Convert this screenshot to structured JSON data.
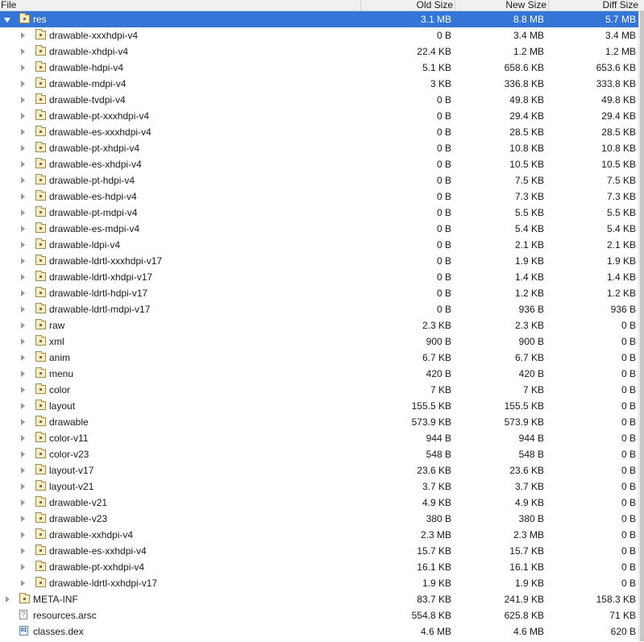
{
  "header": {
    "file": "File",
    "old_size": "Old Size",
    "new_size": "New Size",
    "diff_size": "Diff Size"
  },
  "rows": [
    {
      "name": "res",
      "old": "3.1 MB",
      "new": "8.8 MB",
      "diff": "5.7 MB",
      "level": 0,
      "type": "folder",
      "expanded": true,
      "selected": true
    },
    {
      "name": "drawable-xxxhdpi-v4",
      "old": "0 B",
      "new": "3.4 MB",
      "diff": "3.4 MB",
      "level": 1,
      "type": "folder"
    },
    {
      "name": "drawable-xhdpi-v4",
      "old": "22.4 KB",
      "new": "1.2 MB",
      "diff": "1.2 MB",
      "level": 1,
      "type": "folder"
    },
    {
      "name": "drawable-hdpi-v4",
      "old": "5.1 KB",
      "new": "658.6 KB",
      "diff": "653.6 KB",
      "level": 1,
      "type": "folder"
    },
    {
      "name": "drawable-mdpi-v4",
      "old": "3 KB",
      "new": "336.8 KB",
      "diff": "333.8 KB",
      "level": 1,
      "type": "folder"
    },
    {
      "name": "drawable-tvdpi-v4",
      "old": "0 B",
      "new": "49.8 KB",
      "diff": "49.8 KB",
      "level": 1,
      "type": "folder"
    },
    {
      "name": "drawable-pt-xxxhdpi-v4",
      "old": "0 B",
      "new": "29.4 KB",
      "diff": "29.4 KB",
      "level": 1,
      "type": "folder"
    },
    {
      "name": "drawable-es-xxxhdpi-v4",
      "old": "0 B",
      "new": "28.5 KB",
      "diff": "28.5 KB",
      "level": 1,
      "type": "folder"
    },
    {
      "name": "drawable-pt-xhdpi-v4",
      "old": "0 B",
      "new": "10.8 KB",
      "diff": "10.8 KB",
      "level": 1,
      "type": "folder"
    },
    {
      "name": "drawable-es-xhdpi-v4",
      "old": "0 B",
      "new": "10.5 KB",
      "diff": "10.5 KB",
      "level": 1,
      "type": "folder"
    },
    {
      "name": "drawable-pt-hdpi-v4",
      "old": "0 B",
      "new": "7.5 KB",
      "diff": "7.5 KB",
      "level": 1,
      "type": "folder"
    },
    {
      "name": "drawable-es-hdpi-v4",
      "old": "0 B",
      "new": "7.3 KB",
      "diff": "7.3 KB",
      "level": 1,
      "type": "folder"
    },
    {
      "name": "drawable-pt-mdpi-v4",
      "old": "0 B",
      "new": "5.5 KB",
      "diff": "5.5 KB",
      "level": 1,
      "type": "folder"
    },
    {
      "name": "drawable-es-mdpi-v4",
      "old": "0 B",
      "new": "5.4 KB",
      "diff": "5.4 KB",
      "level": 1,
      "type": "folder"
    },
    {
      "name": "drawable-ldpi-v4",
      "old": "0 B",
      "new": "2.1 KB",
      "diff": "2.1 KB",
      "level": 1,
      "type": "folder"
    },
    {
      "name": "drawable-ldrtl-xxxhdpi-v17",
      "old": "0 B",
      "new": "1.9 KB",
      "diff": "1.9 KB",
      "level": 1,
      "type": "folder"
    },
    {
      "name": "drawable-ldrtl-xhdpi-v17",
      "old": "0 B",
      "new": "1.4 KB",
      "diff": "1.4 KB",
      "level": 1,
      "type": "folder"
    },
    {
      "name": "drawable-ldrtl-hdpi-v17",
      "old": "0 B",
      "new": "1.2 KB",
      "diff": "1.2 KB",
      "level": 1,
      "type": "folder"
    },
    {
      "name": "drawable-ldrtl-mdpi-v17",
      "old": "0 B",
      "new": "936 B",
      "diff": "936 B",
      "level": 1,
      "type": "folder"
    },
    {
      "name": "raw",
      "old": "2.3 KB",
      "new": "2.3 KB",
      "diff": "0 B",
      "level": 1,
      "type": "folder"
    },
    {
      "name": "xml",
      "old": "900 B",
      "new": "900 B",
      "diff": "0 B",
      "level": 1,
      "type": "folder"
    },
    {
      "name": "anim",
      "old": "6.7 KB",
      "new": "6.7 KB",
      "diff": "0 B",
      "level": 1,
      "type": "folder"
    },
    {
      "name": "menu",
      "old": "420 B",
      "new": "420 B",
      "diff": "0 B",
      "level": 1,
      "type": "folder"
    },
    {
      "name": "color",
      "old": "7 KB",
      "new": "7 KB",
      "diff": "0 B",
      "level": 1,
      "type": "folder"
    },
    {
      "name": "layout",
      "old": "155.5 KB",
      "new": "155.5 KB",
      "diff": "0 B",
      "level": 1,
      "type": "folder"
    },
    {
      "name": "drawable",
      "old": "573.9 KB",
      "new": "573.9 KB",
      "diff": "0 B",
      "level": 1,
      "type": "folder"
    },
    {
      "name": "color-v11",
      "old": "944 B",
      "new": "944 B",
      "diff": "0 B",
      "level": 1,
      "type": "folder"
    },
    {
      "name": "color-v23",
      "old": "548 B",
      "new": "548 B",
      "diff": "0 B",
      "level": 1,
      "type": "folder"
    },
    {
      "name": "layout-v17",
      "old": "23.6 KB",
      "new": "23.6 KB",
      "diff": "0 B",
      "level": 1,
      "type": "folder"
    },
    {
      "name": "layout-v21",
      "old": "3.7 KB",
      "new": "3.7 KB",
      "diff": "0 B",
      "level": 1,
      "type": "folder"
    },
    {
      "name": "drawable-v21",
      "old": "4.9 KB",
      "new": "4.9 KB",
      "diff": "0 B",
      "level": 1,
      "type": "folder"
    },
    {
      "name": "drawable-v23",
      "old": "380 B",
      "new": "380 B",
      "diff": "0 B",
      "level": 1,
      "type": "folder"
    },
    {
      "name": "drawable-xxhdpi-v4",
      "old": "2.3 MB",
      "new": "2.3 MB",
      "diff": "0 B",
      "level": 1,
      "type": "folder"
    },
    {
      "name": "drawable-es-xxhdpi-v4",
      "old": "15.7 KB",
      "new": "15.7 KB",
      "diff": "0 B",
      "level": 1,
      "type": "folder"
    },
    {
      "name": "drawable-pt-xxhdpi-v4",
      "old": "16.1 KB",
      "new": "16.1 KB",
      "diff": "0 B",
      "level": 1,
      "type": "folder"
    },
    {
      "name": "drawable-ldrtl-xxhdpi-v17",
      "old": "1.9 KB",
      "new": "1.9 KB",
      "diff": "0 B",
      "level": 1,
      "type": "folder"
    },
    {
      "name": "META-INF",
      "old": "83.7 KB",
      "new": "241.9 KB",
      "diff": "158.3 KB",
      "level": 0,
      "type": "folder"
    },
    {
      "name": "resources.arsc",
      "old": "554.8 KB",
      "new": "625.8 KB",
      "diff": "71 KB",
      "level": 0,
      "type": "file"
    },
    {
      "name": "classes.dex",
      "old": "4.6 MB",
      "new": "4.6 MB",
      "diff": "620 B",
      "level": 0,
      "type": "dex"
    }
  ],
  "icons": {
    "folder": "folder-icon",
    "file": "file-icon",
    "dex": "dex-file-icon",
    "expand": "expand-arrow-icon"
  },
  "colors": {
    "selection": "#3476d8",
    "header_bg": "#f0f0f0"
  }
}
